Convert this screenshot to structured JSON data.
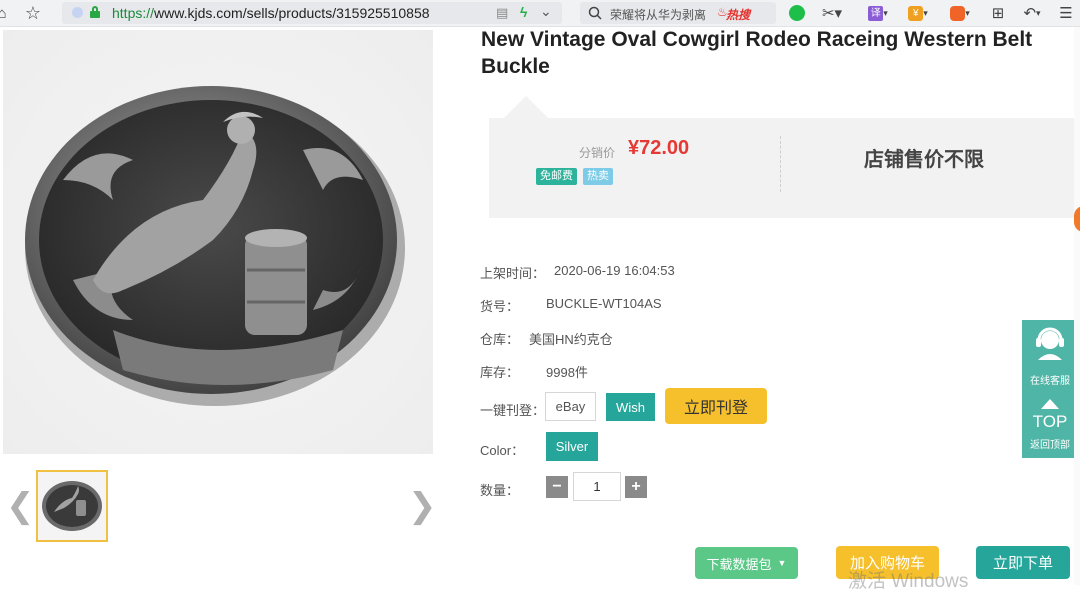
{
  "browser": {
    "url_prefix": "https://",
    "url_rest": "www.kjds.com/sells/products/315925510858",
    "search_query": "荣耀将从华为剥离",
    "search_hot": "热搜"
  },
  "product": {
    "title": "New Vintage Oval Cowgirl Rodeo Raceing Western Belt Buckle",
    "price_label": "分销价",
    "price": "¥72.00",
    "badges": [
      "免邮费",
      "热卖"
    ],
    "shop_price": "店铺售价不限"
  },
  "info": {
    "listed_label": "上架时间：",
    "listed_value": "2020-06-19 16:04:53",
    "sku_label": "货号：",
    "sku_value": "BUCKLE-WT104AS",
    "warehouse_label": "仓库：",
    "warehouse_value": "美国HN约克仓",
    "stock_label": "库存：",
    "stock_value": "9998件",
    "publish_label": "一键刊登：",
    "publish_ebay": "eBay",
    "publish_wish": "Wish",
    "publish_now": "立即刊登",
    "color_label": "Color：",
    "color_value": "Silver",
    "qty_label": "数量：",
    "qty_value": "1"
  },
  "actions": {
    "download": "下载数据包",
    "cart": "加入购物车",
    "buy": "立即下单"
  },
  "float": {
    "service": "在线客服",
    "top": "TOP",
    "back_top": "返回顶部"
  },
  "watermark": "激活 Windows",
  "colors": {
    "teal": "#26a69a",
    "yellow": "#f5c02b",
    "green": "#5bc887",
    "price_red": "#e53935"
  }
}
